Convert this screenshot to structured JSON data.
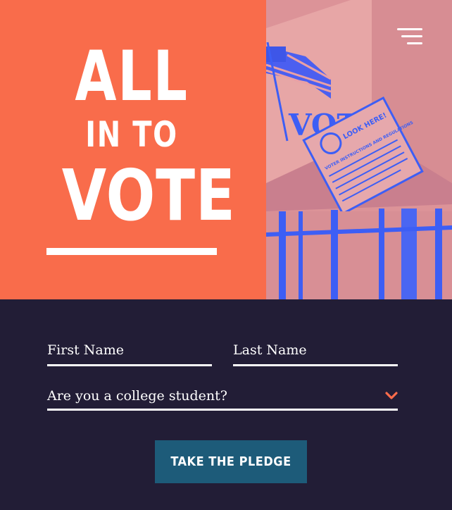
{
  "hero": {
    "logo": {
      "line1": "ALL",
      "line2": "IN TO",
      "line3": "VOTE"
    },
    "photo": {
      "booth_sign": "VOTE",
      "card_title": "VOTER INSTRUCTIONS AND REGULATIONS",
      "card_badge": "LOOK HERE!"
    },
    "menu_icon": "hamburger-menu-icon"
  },
  "form": {
    "first_name_placeholder": "First Name",
    "last_name_placeholder": "Last Name",
    "college_label": "Are you a college student?",
    "chevron_icon": "chevron-down-icon",
    "submit_label": "TAKE THE PLEDGE"
  },
  "colors": {
    "brand_orange": "#f96c4b",
    "navy_background": "#221d36",
    "button_blue": "#1d5b79",
    "photo_pink": "#dc9398",
    "photo_blue": "#3d5ef5"
  }
}
